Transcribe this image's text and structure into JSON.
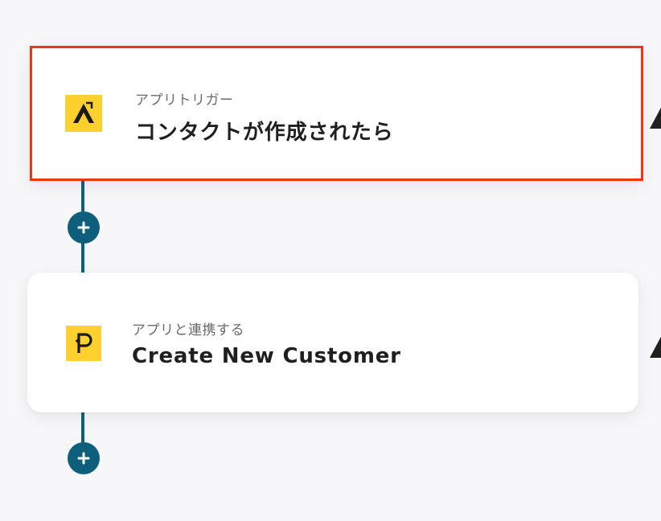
{
  "steps": [
    {
      "label": "アプリトリガー",
      "title": "コンタクトが作成されたら",
      "icon": "triangle-logo-icon",
      "selected": true
    },
    {
      "label": "アプリと連携する",
      "title": "Create New Customer",
      "icon": "p-logo-icon",
      "selected": false
    }
  ],
  "colors": {
    "accent": "#0d5f7c",
    "selection_border": "#f0360e",
    "app_icon_bg": "#ffd02e"
  },
  "add_step_icon": "plus-icon"
}
